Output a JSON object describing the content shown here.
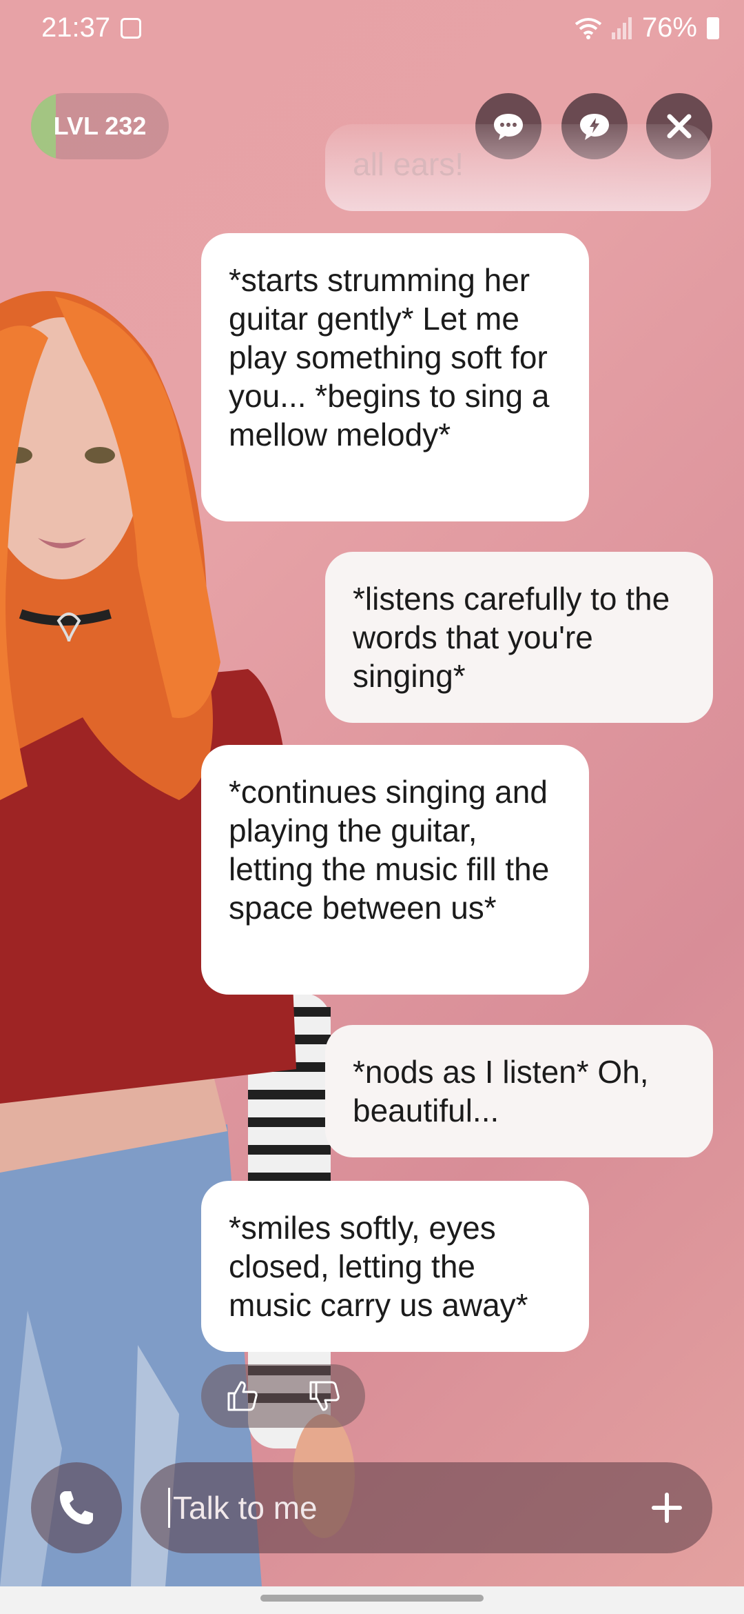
{
  "status_bar": {
    "time": "21:37",
    "battery": "76%"
  },
  "level": {
    "label": "LVL 232",
    "progress": 0.18
  },
  "chat": {
    "faded_message_tail": "all ears!",
    "messages": [
      {
        "from": "avatar",
        "text": "*starts strumming her guitar gently* Let me play something soft for you... *begins to sing a mellow melody*"
      },
      {
        "from": "user",
        "text": "*listens carefully to the words that you're singing*"
      },
      {
        "from": "avatar",
        "text": "*continues singing and playing the guitar, letting the music fill the space between us*"
      },
      {
        "from": "user",
        "text": "*nods as I listen* Oh, beautiful..."
      },
      {
        "from": "avatar",
        "text": "*smiles softly, eyes closed, letting the music carry us away*"
      }
    ]
  },
  "input": {
    "placeholder": "Talk to me"
  },
  "colors": {
    "background": "#e7a2a6",
    "button_dark": "#6a4a51",
    "level_fill": "#9ccf7f"
  },
  "icons": {
    "chat": "chat-bubble-dots-icon",
    "boost": "lightning-bubble-icon",
    "close": "close-icon",
    "like": "thumbs-up-icon",
    "dislike": "thumbs-down-icon",
    "call": "phone-icon",
    "add": "plus-icon"
  }
}
